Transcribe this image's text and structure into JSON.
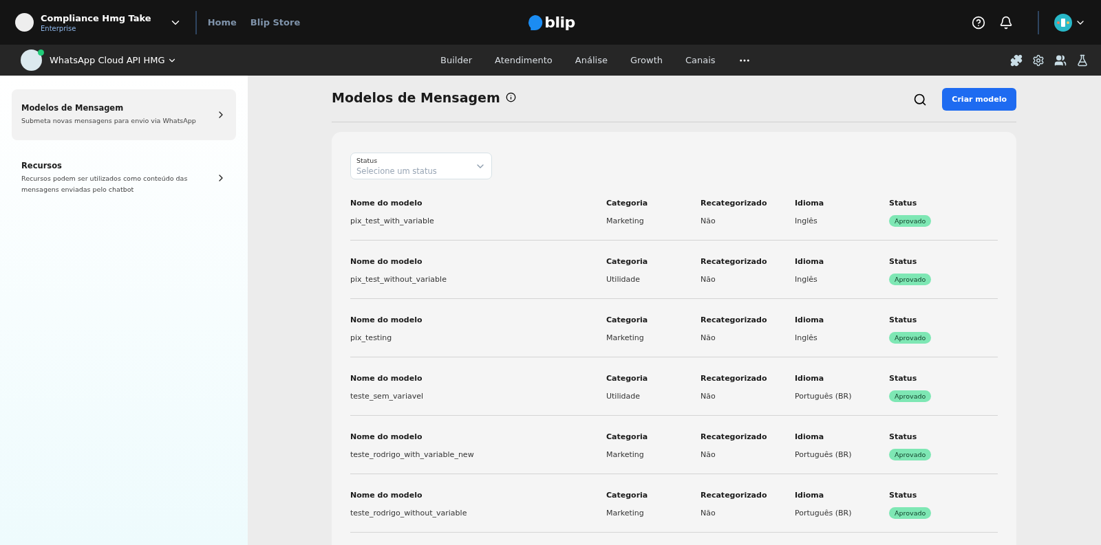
{
  "topbar": {
    "org_name": "Compliance Hmg Take",
    "org_plan": "Enterprise",
    "links": [
      {
        "label": "Home"
      },
      {
        "label": "Blip Store"
      }
    ],
    "brand": "blip"
  },
  "subbar": {
    "bot_name": "WhatsApp Cloud API HMG",
    "bot_online": true,
    "nav": [
      {
        "label": "Builder"
      },
      {
        "label": "Atendimento"
      },
      {
        "label": "Análise"
      },
      {
        "label": "Growth"
      },
      {
        "label": "Canais"
      }
    ]
  },
  "sidebar": {
    "items": [
      {
        "title": "Modelos de Mensagem",
        "description": "Submeta novas mensagens para envio via WhatsApp",
        "selected": true
      },
      {
        "title": "Recursos",
        "description": "Recursos podem ser utilizados como conteúdo das mensagens enviadas pelo chatbot",
        "selected": false
      }
    ]
  },
  "page": {
    "title": "Modelos de Mensagem",
    "create_button": "Criar modelo"
  },
  "filter": {
    "label": "Status",
    "placeholder": "Selecione um status"
  },
  "rows": [
    {
      "headers": [
        "Nome do modelo",
        "Categoria",
        "Recategorizado",
        "Idioma",
        "Status"
      ],
      "name": "pix_test_with_variable",
      "category": "Marketing",
      "recategorized": "Não",
      "language": "Inglês",
      "status": "Aprovado"
    },
    {
      "headers": [
        "Nome do modelo",
        "Categoria",
        "Recategorizado",
        "Idioma",
        "Status"
      ],
      "name": "pix_test_without_variable",
      "category": "Utilidade",
      "recategorized": "Não",
      "language": "Inglês",
      "status": "Aprovado"
    },
    {
      "headers": [
        "Nome do modelo",
        "Categoria",
        "Recategorizado",
        "Idioma",
        "Status"
      ],
      "name": "pix_testing",
      "category": "Marketing",
      "recategorized": "Não",
      "language": "Inglês",
      "status": "Aprovado"
    },
    {
      "headers": [
        "Nome do modelo",
        "Categoria",
        "Recategorizado",
        "Idioma",
        "Status"
      ],
      "name": "teste_sem_variavel",
      "category": "Utilidade",
      "recategorized": "Não",
      "language": "Português (BR)",
      "status": "Aprovado"
    },
    {
      "headers": [
        "Nome do modelo",
        "Categoria",
        "Recategorizado",
        "Idioma",
        "Status"
      ],
      "name": "teste_rodrigo_with_variable_new",
      "category": "Marketing",
      "recategorized": "Não",
      "language": "Português (BR)",
      "status": "Aprovado"
    },
    {
      "headers": [
        "Nome do modelo",
        "Categoria",
        "Recategorizado",
        "Idioma",
        "Status"
      ],
      "name": "teste_rodrigo_without_variable",
      "category": "Marketing",
      "recategorized": "Não",
      "language": "Português (BR)",
      "status": "Aprovado"
    }
  ]
}
